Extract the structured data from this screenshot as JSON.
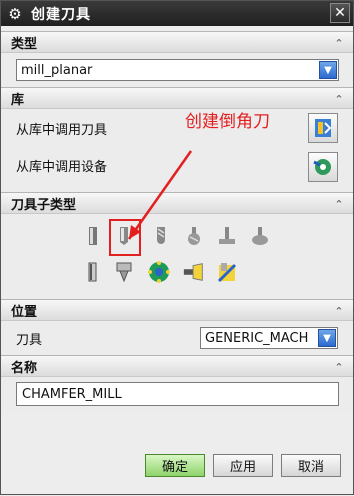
{
  "window": {
    "title": "创建刀具",
    "close_glyph": "✕"
  },
  "sections": {
    "type": {
      "title": "类型",
      "select_value": "mill_planar"
    },
    "library": {
      "title": "库",
      "row1_label": "从库中调用刀具",
      "row2_label": "从库中调用设备"
    },
    "subtype": {
      "title": "刀具子类型"
    },
    "position": {
      "title": "位置",
      "tool_label": "刀具",
      "tool_value": "GENERIC_MACH"
    },
    "name": {
      "title": "名称",
      "value": "CHAMFER_MILL"
    }
  },
  "annotation": {
    "text": "创建倒角刀",
    "color": "#e32020"
  },
  "buttons": {
    "ok": "确定",
    "apply": "应用",
    "cancel": "取消"
  },
  "colors": {
    "accent_blue": "#2d6ad0",
    "ok_green": "#8ed36b",
    "highlight_red": "#e32020"
  }
}
